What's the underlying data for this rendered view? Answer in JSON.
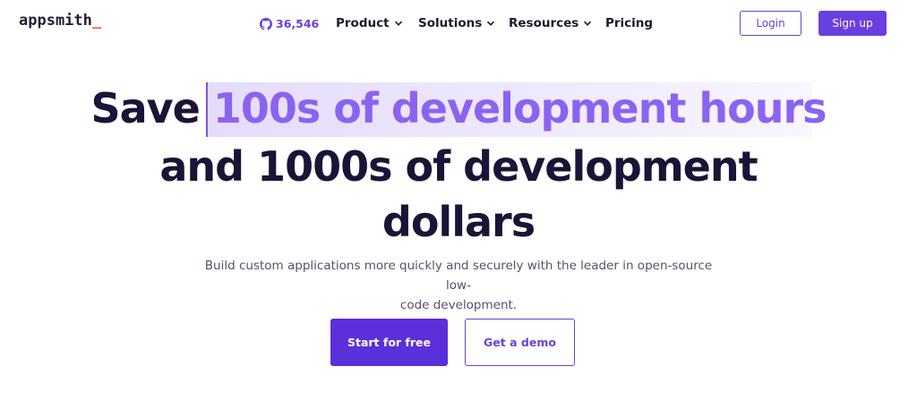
{
  "nav": {
    "logo_text": "appsmith",
    "logo_cursor": "_",
    "github_stars": "36,546",
    "menu": [
      {
        "label": "Product",
        "has_dropdown": true
      },
      {
        "label": "Solutions",
        "has_dropdown": true
      },
      {
        "label": "Resources",
        "has_dropdown": true
      },
      {
        "label": "Pricing",
        "has_dropdown": false
      }
    ],
    "login_label": "Login",
    "signup_label": "Sign up"
  },
  "hero": {
    "line1_prefix": "Save ",
    "line1_highlight": "100s of development hours",
    "line2": "and 1000s of development",
    "line3": "dollars",
    "subtitle_line1": "Build custom applications more quickly and securely with the leader in open-source low-",
    "subtitle_line2": "code development.",
    "primary_cta": "Start for free",
    "secondary_cta": "Get a demo"
  },
  "colors": {
    "brand_purple": "#6a3fe0",
    "highlight_text": "#8b63f0",
    "heading": "#1a1436",
    "logo_accent": "#e9622b"
  }
}
